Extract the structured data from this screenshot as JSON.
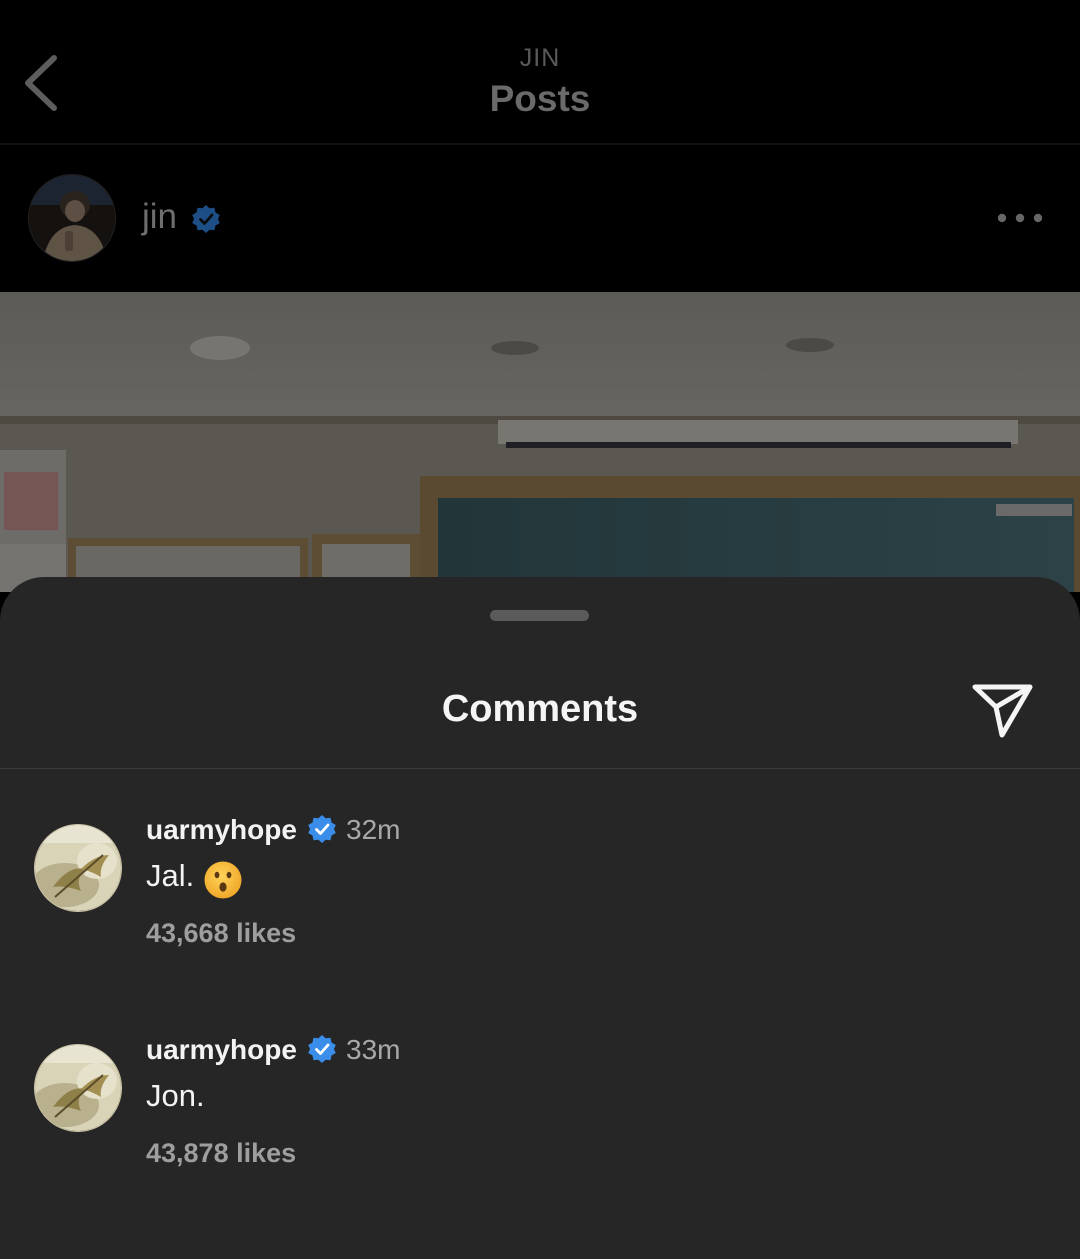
{
  "nav": {
    "subtitle": "JIN",
    "title": "Posts"
  },
  "post": {
    "author": "jin"
  },
  "comments_sheet": {
    "title": "Comments",
    "comments": [
      {
        "username": "uarmyhope",
        "time": "32m",
        "text": "Jal.",
        "emoji": "hushed-face",
        "likes": "43,668 likes"
      },
      {
        "username": "uarmyhope",
        "time": "33m",
        "text": "Jon.",
        "likes": "43,878 likes"
      }
    ]
  },
  "colors": {
    "background": "#000000",
    "sheet": "#262626",
    "verified": "#3897f0",
    "primary_text": "#f5f5f5",
    "secondary_text": "#a8a8a8"
  }
}
